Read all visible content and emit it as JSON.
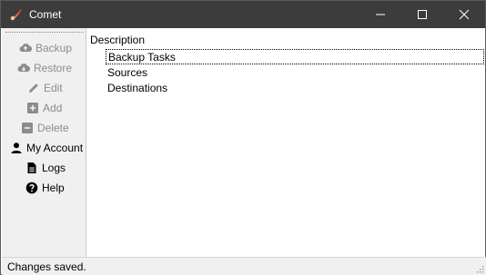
{
  "window": {
    "title": "Comet",
    "app_icon": "comet-logo-icon"
  },
  "sidebar": {
    "items": [
      {
        "label": "Backup",
        "icon": "cloud-upload-icon",
        "enabled": false
      },
      {
        "label": "Restore",
        "icon": "cloud-download-icon",
        "enabled": false
      },
      {
        "label": "Edit",
        "icon": "pencil-icon",
        "enabled": false
      },
      {
        "label": "Add",
        "icon": "plus-square-icon",
        "enabled": false
      },
      {
        "label": "Delete",
        "icon": "minus-square-icon",
        "enabled": false
      },
      {
        "label": "My Account",
        "icon": "user-icon",
        "enabled": true
      },
      {
        "label": "Logs",
        "icon": "document-icon",
        "enabled": true
      },
      {
        "label": "Help",
        "icon": "question-circle-icon",
        "enabled": true
      }
    ]
  },
  "main": {
    "column_header": "Description",
    "items": [
      "Backup Tasks",
      "Sources",
      "Destinations"
    ],
    "selected": "Backup Tasks"
  },
  "status": {
    "text": "Changes saved."
  },
  "colors": {
    "titlebar": "#3c3c3c",
    "sidebar_bg": "#f0f0f0",
    "disabled_text": "#8c8c8c"
  }
}
